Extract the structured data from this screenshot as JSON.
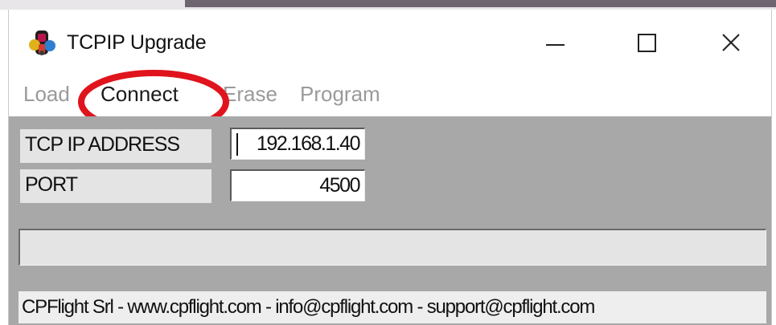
{
  "window": {
    "title": "TCPIP Upgrade",
    "icon": "app-icon",
    "controls": {
      "minimize": "minimize-icon",
      "maximize": "maximize-icon",
      "close": "close-icon"
    }
  },
  "menu": {
    "items": [
      {
        "label": "Load",
        "state": "disabled"
      },
      {
        "label": "Connect",
        "state": "active"
      },
      {
        "label": "Erase",
        "state": "disabled"
      },
      {
        "label": "Program",
        "state": "disabled"
      }
    ]
  },
  "annotation": {
    "color": "#e0141c",
    "target": "Connect"
  },
  "form": {
    "ip_label": "TCP IP ADDRESS",
    "ip_value": "192.168.1.40",
    "port_label": "PORT",
    "port_value": "4500"
  },
  "progress": {
    "value": 0
  },
  "status": {
    "text": "CPFlight Srl -  www.cpflight.com - info@cpflight.com - support@cpflight.com"
  },
  "colors": {
    "client_bg": "#a8a8a8",
    "field_bg": "#e4e4e4",
    "menu_disabled": "#9a9a9a",
    "menu_active": "#1a1a1a"
  }
}
